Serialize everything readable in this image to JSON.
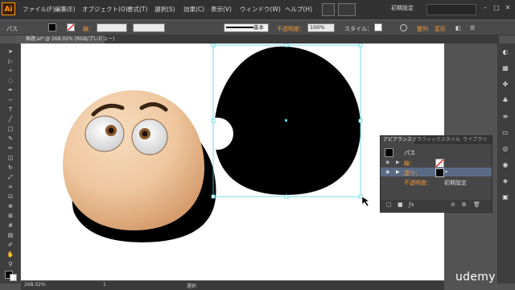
{
  "app": {
    "logo": "Ai",
    "workspace": "初期設定"
  },
  "menu": [
    "ファイル(F)",
    "編集(E)",
    "オブジェクト(O)",
    "書式(T)",
    "選択(S)",
    "効果(C)",
    "表示(V)",
    "ウィンドウ(W)",
    "ヘルプ(H)"
  ],
  "control_bar": {
    "object_type": "パス",
    "stroke_label": "線：",
    "stroke_profile": "基本",
    "opacity_label": "不透明度：",
    "opacity_value": "100%",
    "style_label": "スタイル：",
    "arrange_label": "整列",
    "transform_label": "変形"
  },
  "document": {
    "tab_title": "無題.ai* @ 268.02% (RGB/プレビュー)"
  },
  "appearance_panel": {
    "tabs": [
      "アピアランス",
      "グラフィックスタイル",
      "ライブラリ"
    ],
    "object_label": "パス",
    "stroke_row": "線：",
    "fill_row": "塗り：",
    "opacity_row": "不透明度：",
    "opacity_value": "初期設定"
  },
  "status_bar": {
    "zoom": "268.02%",
    "page": "1",
    "tool": "選択"
  },
  "watermark": "udemy",
  "colors": {
    "accent_orange": "#f39a3a",
    "selection_cyan": "#4fd6e0",
    "fill": "#000000"
  }
}
